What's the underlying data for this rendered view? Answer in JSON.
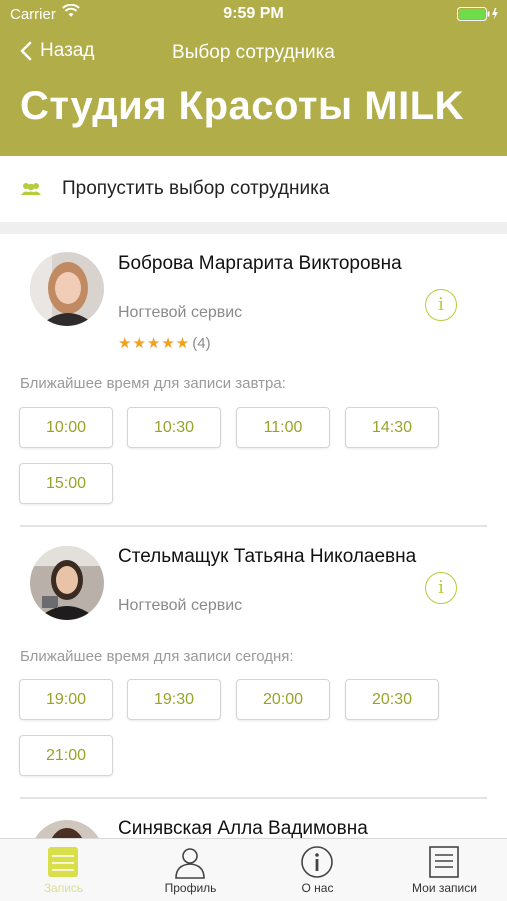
{
  "status": {
    "carrier": "Carrier",
    "time": "9:59 PM"
  },
  "nav": {
    "back": "Назад",
    "title": "Выбор сотрудника",
    "studio": "Студия Красоты MILK"
  },
  "skip": {
    "label": "Пропустить выбор сотрудника"
  },
  "employees": [
    {
      "name": "Боброва Маргарита Викторовна",
      "role": "Ногтевой сервис",
      "stars": "★★★★★",
      "rating_count": "(4)",
      "caption": "Ближайшее время для записи завтра:",
      "slots": [
        "10:00",
        "10:30",
        "11:00",
        "14:30",
        "15:00"
      ]
    },
    {
      "name": "Стельмащук Татьяна Николаевна",
      "role": "Ногтевой сервис",
      "caption": "Ближайшее время для записи сегодня:",
      "slots": [
        "19:00",
        "19:30",
        "20:00",
        "20:30",
        "21:00"
      ]
    },
    {
      "name": "Синявская Алла Вадимовна"
    }
  ],
  "tabs": [
    {
      "label": "Запись",
      "icon": "calendar-icon"
    },
    {
      "label": "Профиль",
      "icon": "person-icon"
    },
    {
      "label": "О нас",
      "icon": "info-icon"
    },
    {
      "label": "Мои записи",
      "icon": "list-icon"
    }
  ],
  "colors": {
    "header": "#b1ad49",
    "accent": "#b7cc3c",
    "slot_text": "#9aa329",
    "star": "#f2a11f"
  }
}
